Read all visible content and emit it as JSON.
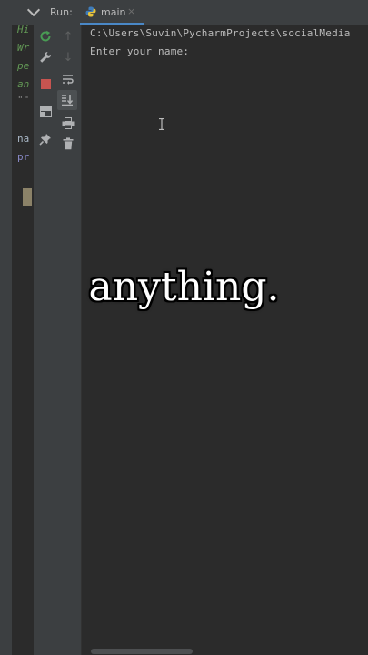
{
  "editor": {
    "lines": [
      {
        "text": "Hi",
        "style": "comment"
      },
      {
        "text": "Wr",
        "style": "comment"
      },
      {
        "text": "pe",
        "style": "comment"
      },
      {
        "text": "an",
        "style": "comment"
      },
      {
        "text": "\"\"",
        "style": "docstring"
      },
      {
        "text": "na",
        "style": "name"
      },
      {
        "text": "pr",
        "style": "builtin"
      }
    ]
  },
  "run_panel": {
    "label": "Run:",
    "tab_label": "main",
    "tab_close": "×"
  },
  "console": {
    "lines": [
      "C:\\Users\\Suvin\\PycharmProjects\\socialMedia",
      "Enter your name:"
    ]
  },
  "caption": "anything.",
  "colors": {
    "background": "#2b2b2b",
    "panel": "#3c3f41",
    "tab_underline": "#4a88c7",
    "rerun": "#499c54",
    "stop": "#c75450",
    "comment": "#629755",
    "console_text": "#bbbbbb"
  },
  "icons": {
    "toolbar_left": [
      "rerun-icon",
      "wrench-icon",
      "stop-icon",
      "layout-icon",
      "pin-icon"
    ],
    "toolbar_right": [
      "up-arrow-icon",
      "down-arrow-icon",
      "soft-wrap-icon",
      "scroll-to-end-icon",
      "print-icon",
      "trash-icon"
    ]
  }
}
